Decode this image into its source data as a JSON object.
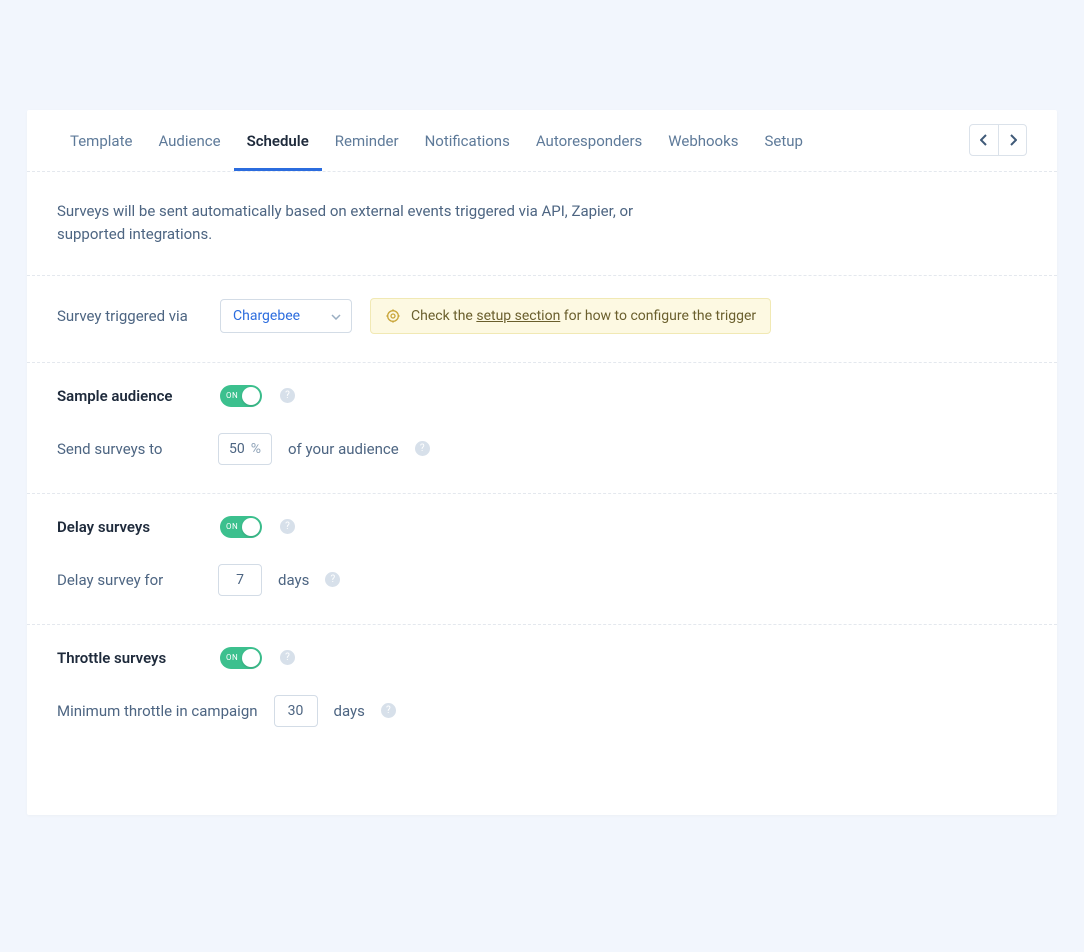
{
  "tabs": {
    "items": [
      {
        "label": "Template"
      },
      {
        "label": "Audience"
      },
      {
        "label": "Schedule"
      },
      {
        "label": "Reminder"
      },
      {
        "label": "Notifications"
      },
      {
        "label": "Autoresponders"
      },
      {
        "label": "Webhooks"
      },
      {
        "label": "Setup"
      }
    ],
    "active_index": 2
  },
  "intro": {
    "text": "Surveys will be sent automatically based on external events triggered via API, Zapier, or supported integrations."
  },
  "trigger": {
    "label": "Survey triggered via",
    "value": "Chargebee",
    "callout_prefix": "Check the",
    "callout_link": "setup section",
    "callout_suffix": "for how to configure the trigger"
  },
  "sample": {
    "title": "Sample audience",
    "toggle_on": "ON",
    "send_label": "Send surveys to",
    "value": "50",
    "unit": "%",
    "after": "of your audience"
  },
  "delay": {
    "title": "Delay surveys",
    "toggle_on": "ON",
    "row_label": "Delay survey for",
    "value": "7",
    "after": "days"
  },
  "throttle": {
    "title": "Throttle surveys",
    "toggle_on": "ON",
    "row_label": "Minimum throttle in campaign",
    "value": "30",
    "after": "days"
  },
  "help_glyph": "?"
}
